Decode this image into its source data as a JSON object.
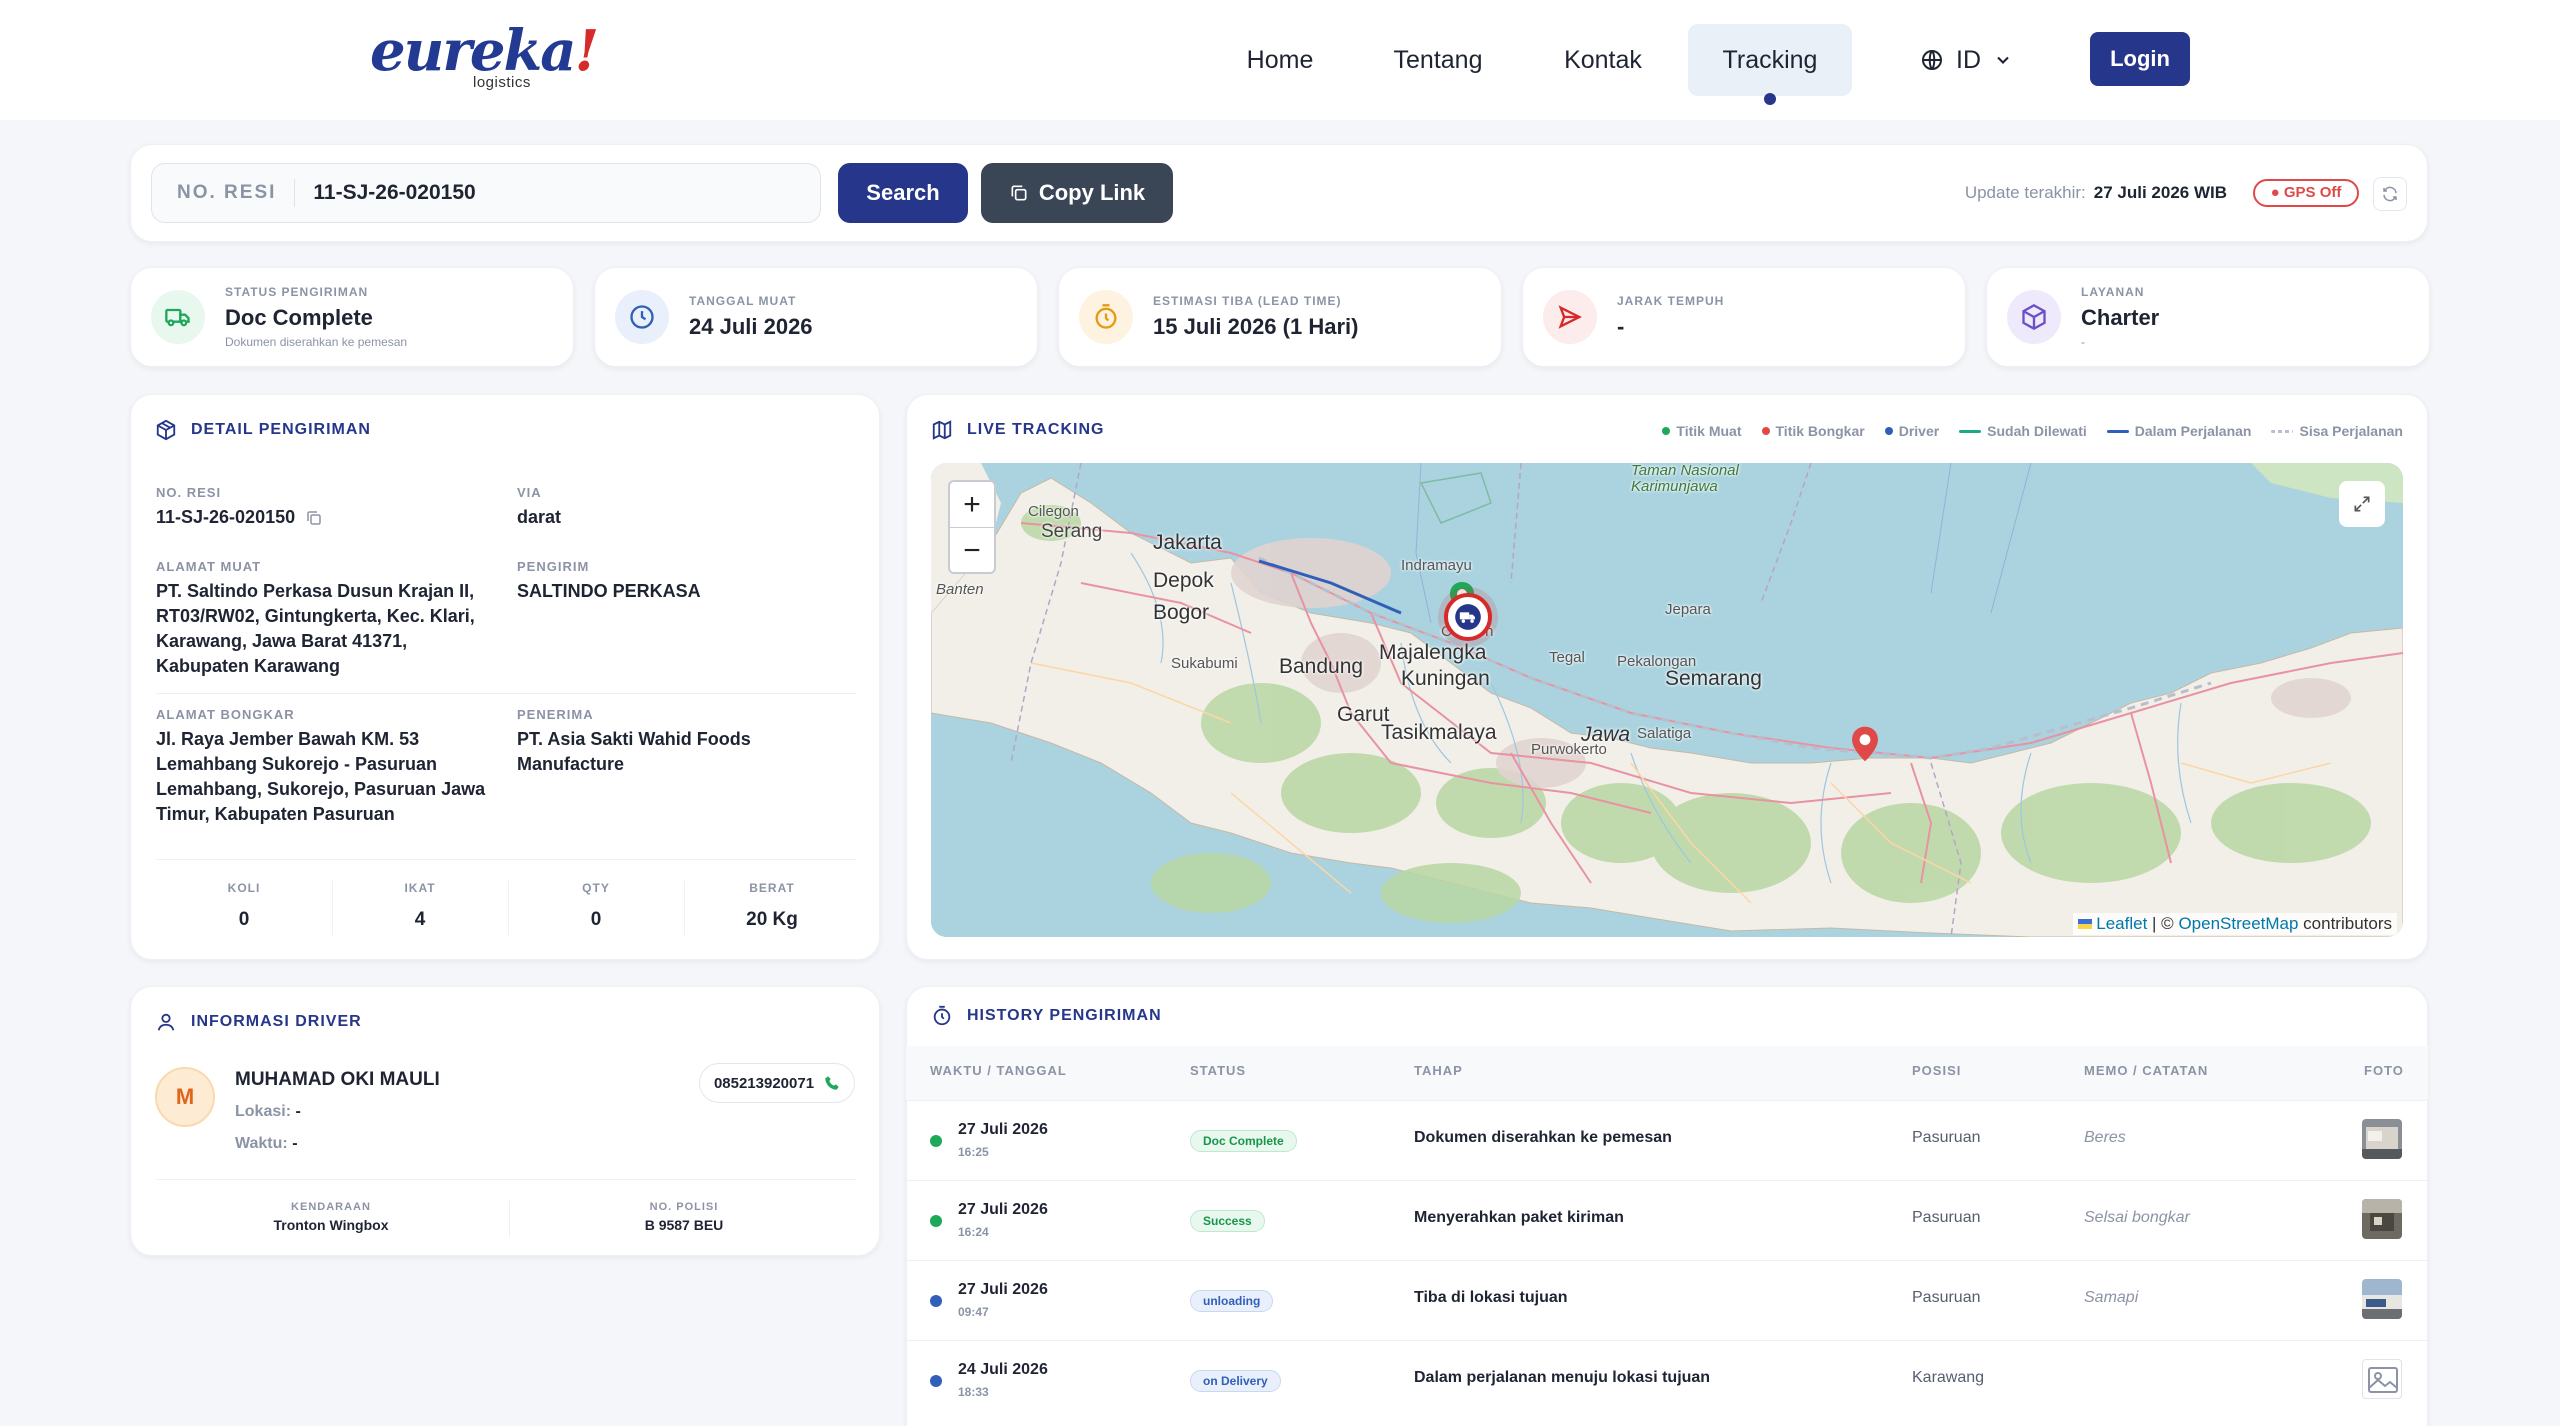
{
  "nav": {
    "logo_text": "eureka",
    "logo_bang": "!",
    "logo_sub": "logistics",
    "items": [
      {
        "label": "Home"
      },
      {
        "label": "Tentang"
      },
      {
        "label": "Kontak"
      },
      {
        "label": "Tracking",
        "active": true
      }
    ],
    "lang": "ID",
    "login_label": "Login"
  },
  "search": {
    "label": "NO. RESI",
    "value": "11-SJ-26-020150",
    "search_label": "Search",
    "copy_label": "Copy Link",
    "update_label": "Update terakhir:",
    "update_value": "27 Juli 2026 WIB",
    "gps_label": "GPS Off"
  },
  "stats": [
    {
      "label": "STATUS PENGIRIMAN",
      "value": "Doc Complete",
      "sub": "Dokumen diserahkan ke pemesan",
      "icon": "truck-icon",
      "color": "#1ea85a"
    },
    {
      "label": "TANGGAL MUAT",
      "value": "24 Juli 2026",
      "sub": "",
      "icon": "clock-icon",
      "color": "#2f5fb8"
    },
    {
      "label": "ESTIMASI TIBA (LEAD TIME)",
      "value": "15 Juli 2026 (1 Hari)",
      "sub": "",
      "icon": "timer-icon",
      "color": "#e49a14"
    },
    {
      "label": "JARAK TEMPUH",
      "value": "-",
      "sub": "",
      "icon": "send-icon",
      "color": "#d62b2b"
    },
    {
      "label": "LAYANAN",
      "value": "Charter",
      "sub": "-",
      "icon": "box-icon",
      "color": "#6c4fc9"
    }
  ],
  "detail": {
    "title": "DETAIL PENGIRIMAN",
    "no_resi_label": "NO. RESI",
    "no_resi": "11-SJ-26-020150",
    "via_label": "VIA",
    "via": "darat",
    "alamat_muat_label": "ALAMAT MUAT",
    "alamat_muat_lines": [
      "PT. Saltindo Perkasa Dusun Krajan II,",
      "RT03/RW02, Gintungkerta, Kec. Klari,",
      "Karawang, Jawa Barat 41371,",
      "Kabupaten Karawang"
    ],
    "pengirim_label": "PENGIRIM",
    "pengirim": "SALTINDO PERKASA",
    "alamat_bongkar_label": "ALAMAT BONGKAR",
    "alamat_bongkar_lines": [
      "Jl. Raya Jember Bawah KM. 53",
      "Lemahbang Sukorejo - Pasuruan",
      "Lemahbang, Sukorejo, Pasuruan Jawa",
      "Timur, Kabupaten Pasuruan"
    ],
    "penerima_label": "PENERIMA",
    "penerima_lines": [
      "PT. Asia Sakti Wahid Foods",
      "Manufacture"
    ],
    "totals": [
      {
        "label": "KOLI",
        "value": "0"
      },
      {
        "label": "IKAT",
        "value": "4"
      },
      {
        "label": "QTY",
        "value": "0"
      },
      {
        "label": "BERAT",
        "value": "20 Kg"
      }
    ]
  },
  "tracking": {
    "title": "LIVE TRACKING",
    "legend": [
      {
        "label": "Titik Muat",
        "kind": "dot",
        "color": "#1ea85a"
      },
      {
        "label": "Titik Bongkar",
        "kind": "dot",
        "color": "#e14848"
      },
      {
        "label": "Driver",
        "kind": "dot",
        "color": "#2f5fb8"
      },
      {
        "label": "Sudah Dilewati",
        "kind": "line",
        "color": "#1ea88a"
      },
      {
        "label": "Dalam Perjalanan",
        "kind": "line",
        "color": "#2f5fb8"
      },
      {
        "label": "Sisa Perjalanan",
        "kind": "dash",
        "color": "#b8bfcc"
      }
    ],
    "zoom_in": "+",
    "zoom_out": "−",
    "attrib_leaflet": "Leaflet",
    "attrib_sep": " | © ",
    "attrib_osm": "OpenStreetMap",
    "attrib_rest": " contributors",
    "places": [
      {
        "name": "Cilegon"
      },
      {
        "name": "Serang"
      },
      {
        "name": "Jakarta"
      },
      {
        "name": "Depok"
      },
      {
        "name": "Bogor"
      },
      {
        "name": "Indramayu"
      },
      {
        "name": "Cirebon"
      },
      {
        "name": "Majalengka"
      },
      {
        "name": "Kuningan"
      },
      {
        "name": "Bandung"
      },
      {
        "name": "Sukabumi"
      },
      {
        "name": "Garut"
      },
      {
        "name": "Tasikmalaya"
      },
      {
        "name": "Tegal"
      },
      {
        "name": "Pekalongan"
      },
      {
        "name": "Semarang"
      },
      {
        "name": "Jepara"
      },
      {
        "name": "Banten"
      },
      {
        "name": "Jawa"
      },
      {
        "name": "Purwokerto"
      },
      {
        "name": "Salatiga"
      },
      {
        "name": "Taman Nasional Karimunjawa"
      }
    ]
  },
  "driver": {
    "title": "INFORMASI DRIVER",
    "initial": "M",
    "name": "MUHAMAD OKI MAULI",
    "lokasi_label": "Lokasi:",
    "lokasi": "-",
    "waktu_label": "Waktu:",
    "waktu": "-",
    "phone": "085213920071",
    "kendaraan_label": "KENDARAAN",
    "kendaraan": "Tronton Wingbox",
    "polisi_label": "NO. POLISI",
    "polisi": "B 9587 BEU"
  },
  "history": {
    "title": "HISTORY PENGIRIMAN",
    "columns": [
      "WAKTU / TANGGAL",
      "STATUS",
      "TAHAP",
      "POSISI",
      "MEMO / CATATAN",
      "FOTO"
    ],
    "rows": [
      {
        "date": "27 Juli 2026",
        "time": "16:25",
        "status": "Doc Complete",
        "tone": "green",
        "tahap": "Dokumen diserahkan ke pemesan",
        "posisi": "Pasuruan",
        "memo": "Beres",
        "foto": "photo"
      },
      {
        "date": "27 Juli 2026",
        "time": "16:24",
        "status": "Success",
        "tone": "green",
        "tahap": "Menyerahkan paket kiriman",
        "posisi": "Pasuruan",
        "memo": "Selsai bongkar",
        "foto": "photo"
      },
      {
        "date": "27 Juli 2026",
        "time": "09:47",
        "status": "unloading",
        "tone": "blue",
        "tahap": "Tiba di lokasi tujuan",
        "posisi": "Pasuruan",
        "memo": "Samapi",
        "foto": "photo"
      },
      {
        "date": "24 Juli 2026",
        "time": "18:33",
        "status": "on Delivery",
        "tone": "blue",
        "tahap": "Dalam perjalanan menuju lokasi tujuan",
        "posisi": "Karawang",
        "memo": "",
        "foto": "placeholder"
      }
    ]
  }
}
